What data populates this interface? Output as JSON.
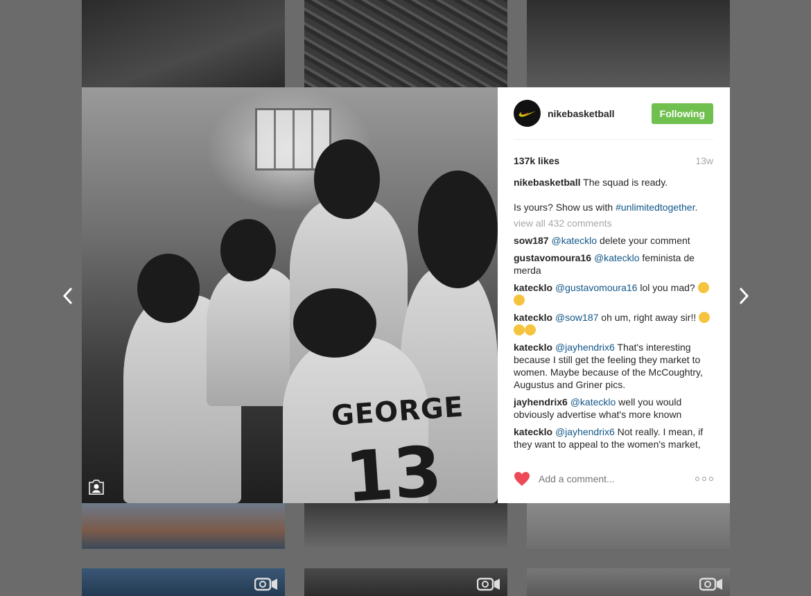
{
  "post": {
    "username": "nikebasketball",
    "follow_label": "Following",
    "likes": "137k likes",
    "age": "13w",
    "caption_text": "The squad is ready.",
    "caption_line2_pre": "Is yours? Show us with ",
    "caption_hashtag": "#unlimitedtogether",
    "caption_line2_post": ".",
    "view_all": "view all 432 comments",
    "jersey_name": "GEORGE",
    "jersey_number": "13"
  },
  "comments": [
    {
      "user": "sow187",
      "mention": "@katecklo",
      "text": " delete your comment"
    },
    {
      "user": "gustavomoura16",
      "mention": "@katecklo",
      "text": " feminista de merda"
    },
    {
      "user": "katecklo",
      "mention": "@gustavomoura16",
      "text": " lol you mad?"
    },
    {
      "user": "katecklo",
      "mention": "@sow187",
      "text": " oh um, right away sir!!"
    },
    {
      "user": "katecklo",
      "mention": "@jayhendrix6",
      "text": " That's interesting because I still get the feeling they market to women. Maybe because of the McCoughtry, Augustus and Griner pics."
    },
    {
      "user": "jayhendrix6",
      "mention": "@katecklo",
      "text": " well you would obviously advertise what's more known"
    },
    {
      "user": "katecklo",
      "mention": "@jayhendrix6",
      "text": " Not really. I mean, if they want to appeal to the women's market,"
    }
  ],
  "add_comment": {
    "placeholder": "Add a comment..."
  },
  "colors": {
    "follow_green": "#70c050",
    "heart_red": "#ed4956",
    "mention_blue": "#125688"
  },
  "icons": [
    "chevron-left-icon",
    "chevron-right-icon",
    "nike-swoosh-icon",
    "heart-icon",
    "more-options-icon",
    "tagged-user-icon",
    "video-icon"
  ]
}
